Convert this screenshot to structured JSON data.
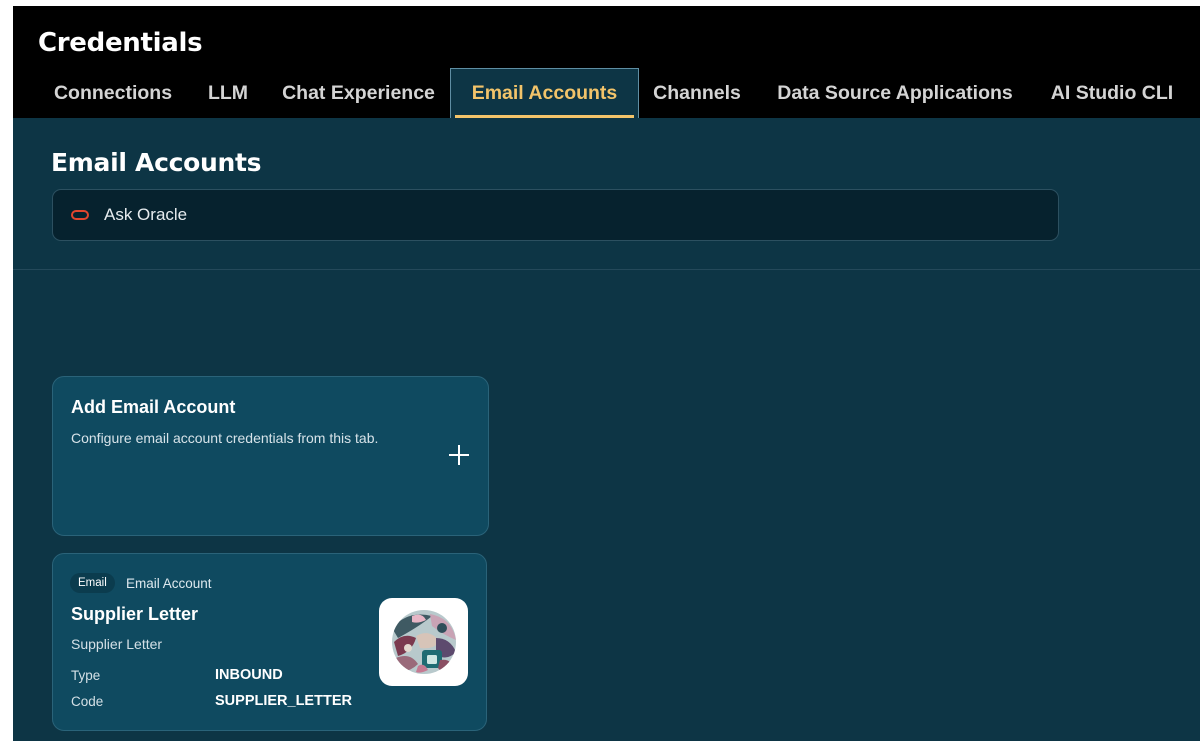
{
  "header": {
    "title": "Credentials"
  },
  "tabs": [
    {
      "label": "Connections",
      "active": false
    },
    {
      "label": "LLM",
      "active": false
    },
    {
      "label": "Chat Experience",
      "active": false
    },
    {
      "label": "Email Accounts",
      "active": true
    },
    {
      "label": "Channels",
      "active": false
    },
    {
      "label": "Data Source Applications",
      "active": false
    },
    {
      "label": "AI Studio CLI",
      "active": false
    }
  ],
  "main": {
    "title": "Email Accounts",
    "ask": {
      "label": "Ask Oracle",
      "icon": "oracle-ring-icon"
    },
    "add_card": {
      "title": "Add Email Account",
      "description": "Configure email account credentials from this tab.",
      "icon": "plus-icon"
    },
    "accounts": [
      {
        "badge": "Email",
        "kind": "Email Account",
        "name": "Supplier Letter",
        "description": "Supplier Letter",
        "fields": [
          {
            "label": "Type",
            "value": "INBOUND"
          },
          {
            "label": "Code",
            "value": "SUPPLIER_LETTER"
          }
        ],
        "logo": "abstract-pattern-logo"
      }
    ]
  },
  "colors": {
    "topbar": "#000000",
    "background": "#0d3545",
    "card": "#0f4a60",
    "accent": "#f2c46a",
    "oracle": "#e2462e"
  }
}
